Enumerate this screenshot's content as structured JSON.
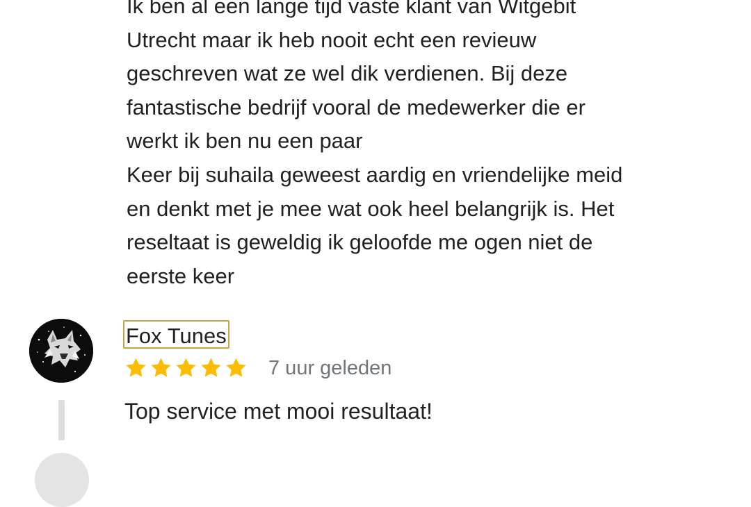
{
  "previous_review": {
    "text": "Ik ben al een lange tijd vaste klant van Witgebit\nUtrecht maar ik heb nooit echt een revieuw\ngeschreven wat ze wel dik verdienen. Bij deze\nfantastische bedrijf vooral de medewerker die er\nwerkt ik ben nu een paar\nKeer bij suhaila geweest aardig en vriendelijke meid\nen denkt met je mee wat ook heel belangrijk is. Het\nreseltaat is geweldig ik geloofde me ogen niet de\neerste keer"
  },
  "review": {
    "avatar_icon": "wolf-avatar-icon",
    "reviewer_name": "Fox Tunes",
    "rating": 5,
    "rating_max": 5,
    "star_color": "#fbbc04",
    "time": "7 uur geleden",
    "text": "Top service met mooi resultaat!"
  },
  "colors": {
    "text": "#202124",
    "secondary_text": "#70757a",
    "name_highlight_border": "#c9a43a"
  }
}
